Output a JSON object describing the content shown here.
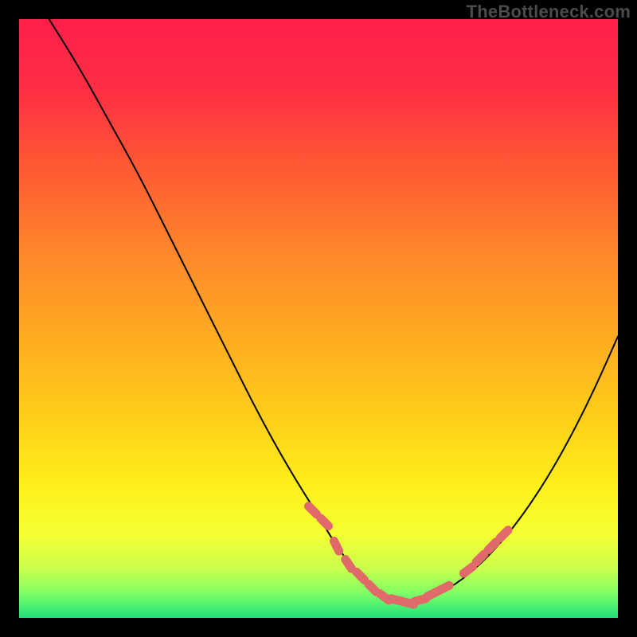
{
  "watermark": "TheBottleneck.com",
  "chart_data": {
    "type": "line",
    "title": "",
    "xlabel": "",
    "ylabel": "",
    "xlim": [
      0,
      100
    ],
    "ylim": [
      0,
      100
    ],
    "grid": false,
    "legend": false,
    "curve": {
      "name": "bottleneck-curve",
      "color": "#000000",
      "x": [
        5,
        10,
        15,
        20,
        25,
        30,
        35,
        40,
        45,
        50,
        53,
        56,
        59,
        62,
        65,
        68,
        72,
        76,
        80,
        84,
        88,
        92,
        96,
        100
      ],
      "y": [
        100,
        92,
        83,
        74,
        64,
        54,
        44,
        34,
        25,
        17,
        12,
        8,
        5,
        3,
        2.5,
        3,
        5,
        8,
        12,
        17,
        23,
        30,
        38,
        47
      ]
    },
    "markers": {
      "name": "highlighted-points",
      "color": "#e06a6a",
      "x": [
        49,
        51,
        53,
        55,
        57,
        59,
        61,
        63,
        65,
        67,
        69,
        71,
        75,
        77,
        79,
        81
      ],
      "y": [
        18,
        16,
        12,
        9,
        7,
        5,
        3.5,
        3,
        2.5,
        3,
        4,
        5,
        8,
        10,
        12,
        14
      ]
    },
    "background_gradient": {
      "stops": [
        {
          "offset": 0.0,
          "color": "#ff1f4b"
        },
        {
          "offset": 0.12,
          "color": "#ff2e44"
        },
        {
          "offset": 0.25,
          "color": "#ff5a33"
        },
        {
          "offset": 0.4,
          "color": "#ff8a2a"
        },
        {
          "offset": 0.55,
          "color": "#ffb01f"
        },
        {
          "offset": 0.68,
          "color": "#ffd21a"
        },
        {
          "offset": 0.78,
          "color": "#fff01a"
        },
        {
          "offset": 0.86,
          "color": "#f5ff33"
        },
        {
          "offset": 0.92,
          "color": "#c7ff4d"
        },
        {
          "offset": 0.96,
          "color": "#7bff66"
        },
        {
          "offset": 1.0,
          "color": "#1fe07a"
        }
      ]
    }
  }
}
